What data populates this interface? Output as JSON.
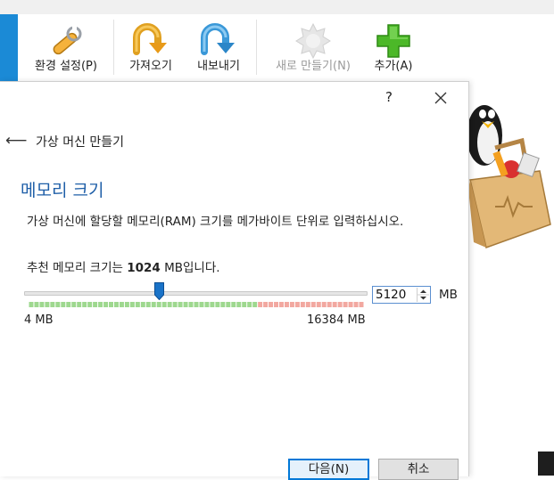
{
  "toolbar": {
    "items": [
      {
        "label": "환경 설정(P)",
        "icon": "wrench-icon",
        "enabled": true
      },
      {
        "label": "가져오기",
        "icon": "import-icon",
        "enabled": true
      },
      {
        "label": "내보내기",
        "icon": "export-icon",
        "enabled": true
      },
      {
        "label": "새로 만들기(N)",
        "icon": "new-gear-icon",
        "enabled": false
      },
      {
        "label": "추가(A)",
        "icon": "add-plus-icon",
        "enabled": true
      }
    ]
  },
  "dialog": {
    "help": "?",
    "wizard_title": "가상 머신 만들기",
    "page_title": "메모리 크기",
    "description": "가상 머신에 할당할 메모리(RAM) 크기를 메가바이트 단위로 입력하십시오.",
    "recommend_prefix": "추천 메모리 크기는 ",
    "recommend_value": "1024",
    "recommend_suffix": " MB입니다.",
    "slider": {
      "min": 4,
      "max": 16384,
      "value": 5120,
      "min_label": "4 MB",
      "max_label": "16384 MB"
    },
    "spin_value": "5120",
    "unit": "MB",
    "next_button": "다음(N)",
    "cancel_button": "취소"
  },
  "colors": {
    "accent": "#1f5fa8",
    "slider_thumb": "#1a73c8",
    "tick_green": "#9ed88f",
    "tick_red": "#f2a8a0"
  }
}
